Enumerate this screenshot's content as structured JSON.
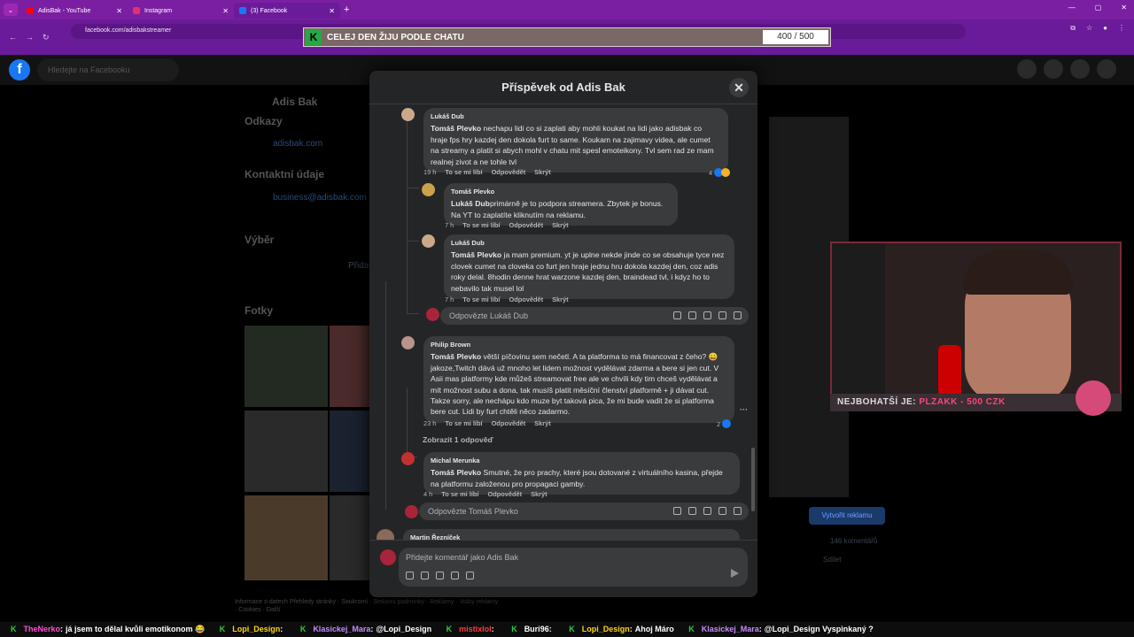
{
  "browser": {
    "tabs": [
      {
        "title": "AdisBak - YouTube",
        "color": "#ff0000"
      },
      {
        "title": "Instagram",
        "color": "#e1306c"
      },
      {
        "title": "(3) Facebook",
        "color": "#1877f2"
      }
    ],
    "url": "facebook.com/adisbakstreamer"
  },
  "overlay_goal": {
    "badge": "K",
    "text": "CELEJ DEN ŽIJU PODLE CHATU",
    "value": "400 / 500"
  },
  "fb": {
    "search_placeholder": "Hledejte na Facebooku",
    "profile_name": "Adis Bak",
    "sections": {
      "links": "Odkazy",
      "link_url": "adisbak.com",
      "contact": "Kontaktní údaje",
      "email": "business@adisbak.com",
      "featured": "Výběr",
      "add": "Přidat",
      "photos": "Fotky",
      "create_ad": "Vytvořit reklamu",
      "comments_count": "146 komentářů",
      "share": "Sdílet"
    },
    "footer_left": "Informace o datech  Přehledy stránky · Soukromí · Smluvní podmínky · Reklamy · Volby reklamy  · Cookies · Další"
  },
  "modal": {
    "title": "Příspěvek od Adis Bak",
    "comments": [
      {
        "name": "Lukáš Dub",
        "tag": "Tomáš Plevko",
        "text": " nechapu lidi co si zaplati aby mohli koukat na lidi jako adisbak co hraje fps hry kazdej den dokola furt to same. Koukam na zajimavy videa, ale cumet na streamy a platit si abych mohl v chatu mit spesl emoteikony. Tvl sem rad ze mam realnej zivot a ne tohle tvl",
        "time": "19 h",
        "like": "To se mi líbí",
        "reply": "Odpovědět",
        "hide": "Skrýt",
        "reactions": "4"
      },
      {
        "name": "Tomáš Plevko",
        "tag": "Lukáš Dub",
        "text": "primárně je to podpora streamera. Zbytek je bonus. Na YT to zaplatíte kliknutím na reklamu.",
        "time": "7 h",
        "like": "To se mi líbí",
        "reply": "Odpovědět",
        "hide": "Skrýt"
      },
      {
        "name": "Lukáš Dub",
        "tag": "Tomáš Plevko",
        "text": " ja mam premium. yt je uplne nekde jinde co se obsahuje tyce nez clovek cumet na cloveka co furt jen hraje jednu hru dokola kazdej den, coz adis roky delal. 8hodin denne hrat warzone kazdej den, braindead tvl, i kdyz ho to nebavilo tak musel lol",
        "time": "7 h",
        "like": "To se mi líbí",
        "reply": "Odpovědět",
        "hide": "Skrýt"
      },
      {
        "name": "Philip Brown",
        "tag": "Tomáš Plevko",
        "text": " větší píčovinu sem nečetl. A ta platforma to má financovat z čeho? 😀 jakoze,Twitch dává už mnoho let lidem možnost vydělávat zdarma a bere si jen cut. V Asii mas platformy kde můžeš streamovat free ale ve chvíli kdy tim chceš vydělávat a mít možnost subu a dona, tak musíš platit měsíční členství platformě + ji dávat cut. Takze sorry, ale nechápu kdo muze byt taková pica, že mi bude vadit že si platforma bere cut. Lidi by furt chtěli něco zadarmo.",
        "time": "23 h",
        "like": "To se mi líbí",
        "reply": "Odpovědět",
        "hide": "Skrýt",
        "reactions": "2"
      },
      {
        "name": "Michal Merunka",
        "tag": "Tomáš Plevko",
        "text": " Smutné, že pro prachy, které jsou dotované z virtuálního kasina, přejde na platformu založenou pro propagaci gamby.",
        "time": "4 h",
        "like": "To se mi líbí",
        "reply": "Odpovědět",
        "hide": "Skrýt"
      }
    ],
    "reply_box_1": "Odpovězte Lukáš Dub",
    "show_replies": "Zobrazit 1 odpověď",
    "reply_box_2": "Odpovězte Tomáš Plevko",
    "next_name": "Martin Řezníček",
    "composer_placeholder": "Přidejte komentář jako Adis Bak"
  },
  "stream_overlay": {
    "label": "NEJBOHATŠÍ JE:",
    "value": "PLZAKK - 500 CZK"
  },
  "chat": [
    {
      "user": "TheNerko",
      "color": "#ff4fd8",
      "msg": "já jsem to dělal kvůli emotikonom 😂"
    },
    {
      "user": "Lopi_Design",
      "color": "#ffd400",
      "msg": ""
    },
    {
      "user": "Klasickej_Mara",
      "color": "#c58aff",
      "msg": "@Lopi_Design"
    },
    {
      "user": "mistixlol",
      "color": "#ff3b3b",
      "msg": ""
    },
    {
      "user": "Buri96",
      "color": "#ffffff",
      "msg": ""
    },
    {
      "user": "Lopi_Design",
      "color": "#ffd400",
      "msg": "Ahoj Máro"
    },
    {
      "user": "Klasickej_Mara",
      "color": "#c58aff",
      "msg": "@Lopi_Design Vyspinkaný ?"
    }
  ]
}
